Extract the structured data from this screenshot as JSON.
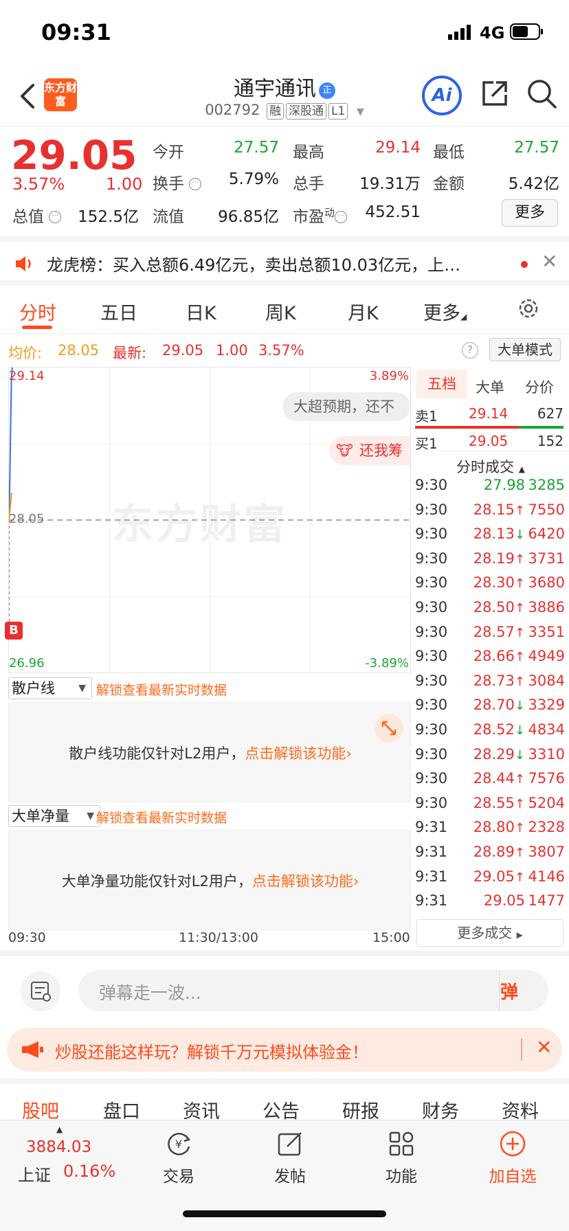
{
  "status": {
    "time": "09:31",
    "network": "4G"
  },
  "header": {
    "logo_text": "东方财富",
    "stock_name": "通宇通讯",
    "name_badge": "正",
    "code": "002792",
    "tags": [
      "融",
      "深股通",
      "L1"
    ],
    "ai_label": "Ai"
  },
  "quote": {
    "price": "29.05",
    "change_pct": "3.57%",
    "change": "1.00",
    "open_label": "今开",
    "open": "27.57",
    "high_label": "最高",
    "high": "29.14",
    "low_label": "最低",
    "low": "27.57",
    "turnover_label": "换手",
    "turnover": "5.79%",
    "volume_label": "总手",
    "volume": "19.31万",
    "amount_label": "金额",
    "amount": "5.42亿",
    "mktcap_label": "总值",
    "mktcap": "152.5亿",
    "float_label": "流值",
    "float": "96.85亿",
    "pe_label": "市盈",
    "pe_sup": "动",
    "pe": "452.51",
    "more_label": "更多"
  },
  "notice": {
    "text": "龙虎榜：买入总额6.49亿元，卖出总额10.03亿元，上…"
  },
  "tabs": [
    "分时",
    "五日",
    "日K",
    "周K",
    "月K",
    "更多"
  ],
  "avg": {
    "avg_label": "均价:",
    "avg_value": "28.05",
    "latest_label": "最新:",
    "latest_value": "29.05",
    "latest_change": "1.00",
    "latest_pct": "3.57%",
    "big_mode": "大单模式"
  },
  "chart": {
    "top_price": "29.14",
    "top_pct": "3.89%",
    "mid_price": "28.05",
    "bottom_price": "26.96",
    "bottom_pct": "-3.89%",
    "watermark": "东方财富",
    "bubble1": "大超预期，还不",
    "bubble2": "还我筹",
    "b_marker": "B"
  },
  "chart_data": {
    "type": "line",
    "ylim": [
      26.96,
      29.14
    ],
    "avg_price": 28.05,
    "series": [
      {
        "values": [
          28.05,
          28.3,
          28.7,
          29.05,
          29.14
        ]
      }
    ]
  },
  "right_panel": {
    "tabs": [
      "五档",
      "大单",
      "分价"
    ],
    "sell1": {
      "label": "卖1",
      "price": "29.14",
      "vol": "627"
    },
    "buy1": {
      "label": "买1",
      "price": "29.05",
      "vol": "152"
    },
    "trades_title": "分时成交",
    "trades": [
      {
        "t": "9:30",
        "p": "27.98",
        "d": "",
        "v": "3285",
        "c": "green"
      },
      {
        "t": "9:30",
        "p": "28.15",
        "d": "↑",
        "v": "7550",
        "c": "red"
      },
      {
        "t": "9:30",
        "p": "28.13",
        "d": "↓",
        "v": "6420",
        "c": "red"
      },
      {
        "t": "9:30",
        "p": "28.19",
        "d": "↑",
        "v": "3731",
        "c": "red"
      },
      {
        "t": "9:30",
        "p": "28.30",
        "d": "↑",
        "v": "3680",
        "c": "red"
      },
      {
        "t": "9:30",
        "p": "28.50",
        "d": "↑",
        "v": "3886",
        "c": "red"
      },
      {
        "t": "9:30",
        "p": "28.57",
        "d": "↑",
        "v": "3351",
        "c": "red"
      },
      {
        "t": "9:30",
        "p": "28.66",
        "d": "↑",
        "v": "4949",
        "c": "red"
      },
      {
        "t": "9:30",
        "p": "28.73",
        "d": "↑",
        "v": "3084",
        "c": "red"
      },
      {
        "t": "9:30",
        "p": "28.70",
        "d": "↓",
        "v": "3329",
        "c": "red"
      },
      {
        "t": "9:30",
        "p": "28.52",
        "d": "↓",
        "v": "4834",
        "c": "red"
      },
      {
        "t": "9:30",
        "p": "28.29",
        "d": "↓",
        "v": "3310",
        "c": "red"
      },
      {
        "t": "9:30",
        "p": "28.44",
        "d": "↑",
        "v": "7576",
        "c": "red"
      },
      {
        "t": "9:30",
        "p": "28.55",
        "d": "↑",
        "v": "5204",
        "c": "red"
      },
      {
        "t": "9:31",
        "p": "28.80",
        "d": "↑",
        "v": "2328",
        "c": "red"
      },
      {
        "t": "9:31",
        "p": "28.89",
        "d": "↑",
        "v": "3807",
        "c": "red"
      },
      {
        "t": "9:31",
        "p": "29.05",
        "d": "↑",
        "v": "4146",
        "c": "red"
      },
      {
        "t": "9:31",
        "p": "29.05",
        "d": "",
        "v": "1477",
        "c": "red"
      }
    ],
    "more_trades": "更多成交"
  },
  "retail": {
    "select": "散户线",
    "unlock": "解锁查看最新实时数据",
    "msg_prefix": "散户线功能仅针对L2用户，",
    "msg_link": "点击解锁该功能"
  },
  "bignet": {
    "select": "大单净量",
    "unlock": "解锁查看最新实时数据",
    "msg_prefix": "大单净量功能仅针对L2用户，",
    "msg_link": "点击解锁该功能"
  },
  "time_axis": [
    "09:30",
    "11:30/13:00",
    "15:00"
  ],
  "barrage": {
    "placeholder": "弹幕走一波...",
    "send": "弹"
  },
  "promo": {
    "text": "炒股还能这样玩？解锁千万元模拟体验金！"
  },
  "bottom_tabs": [
    "股吧",
    "盘口",
    "资讯",
    "公告",
    "研报",
    "财务",
    "资料"
  ],
  "navbar": {
    "index_value": "3884.03",
    "index_name": "上证",
    "index_change": "0.16%",
    "items": [
      "交易",
      "发帖",
      "功能",
      "加自选"
    ]
  },
  "colors": {
    "up": "#e8302f",
    "down": "#1aa531",
    "accent": "#ff4a1a"
  }
}
